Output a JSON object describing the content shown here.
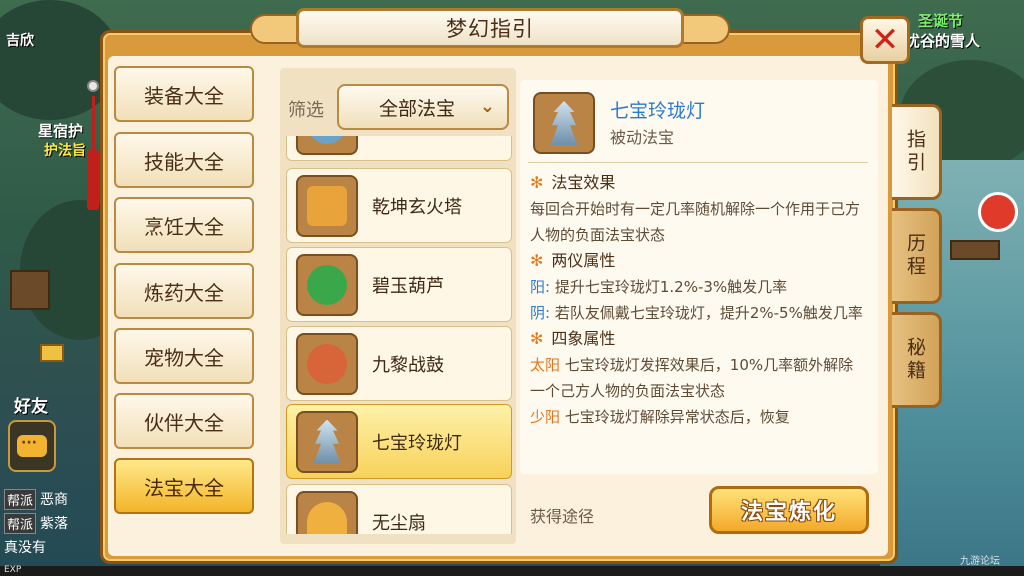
{
  "window": {
    "title": "梦幻指引",
    "close_label": "✕"
  },
  "hud": {
    "top_left": "吉欣",
    "npc_name_1": "星宿护",
    "npc_name_2": "护法旨",
    "friends_label": "好友",
    "event_title": "圣诞节",
    "event_sub": "忧谷的雪人",
    "chat": [
      {
        "tag": "帮派",
        "text": "恶商"
      },
      {
        "tag": "帮派",
        "text": "紫落"
      }
    ],
    "chat_extra": "真没有",
    "exp_label": "EXP",
    "watermark": "九游论坛"
  },
  "menu": {
    "items": [
      {
        "label": "装备大全",
        "active": false
      },
      {
        "label": "技能大全",
        "active": false
      },
      {
        "label": "烹饪大全",
        "active": false
      },
      {
        "label": "炼药大全",
        "active": false
      },
      {
        "label": "宠物大全",
        "active": false
      },
      {
        "label": "伙伴大全",
        "active": false
      },
      {
        "label": "法宝大全",
        "active": true
      }
    ]
  },
  "filter": {
    "label": "筛选",
    "value": "全部法宝"
  },
  "list": {
    "items": [
      {
        "name": "",
        "icon": "beast-icon",
        "color": "#6aa2c8"
      },
      {
        "name": "乾坤玄火塔",
        "icon": "fire-tower-icon",
        "color": "#e8a43a"
      },
      {
        "name": "碧玉葫芦",
        "icon": "gourd-icon",
        "color": "#3aa84a"
      },
      {
        "name": "九黎战鼓",
        "icon": "drum-icon",
        "color": "#d8643a"
      },
      {
        "name": "七宝玲珑灯",
        "icon": "lantern-icon",
        "color": "#8fb0c8",
        "selected": true
      },
      {
        "name": "无尘扇",
        "icon": "fan-icon",
        "color": "#f0b040"
      }
    ]
  },
  "detail": {
    "name": "七宝玲珑灯",
    "type": "被动法宝",
    "sections": {
      "effect_title": "法宝效果",
      "effect_text": "每回合开始时有一定几率随机解除一个作用于己方人物的负面法宝状态",
      "two_title": "两仪属性",
      "yang_label": "阳:",
      "yang_text": "提升七宝玲珑灯1.2%-3%触发几率",
      "yin_label": "阴:",
      "yin_text": "若队友佩戴七宝玲珑灯，提升2%-5%触发几率",
      "four_title": "四象属性",
      "taiyang_label": "太阳",
      "taiyang_text": "七宝玲珑灯发挥效果后，10%几率额外解除一个己方人物的负面法宝状态",
      "shaoyang_label": "少阳",
      "shaoyang_text": "七宝玲珑灯解除异常状态后，恢复"
    },
    "obtain_label": "获得途径",
    "refine_label": "法宝炼化"
  },
  "side_tabs": [
    {
      "label": "指引",
      "active": true
    },
    {
      "label": "历程",
      "active": false
    },
    {
      "label": "秘籍",
      "active": false
    }
  ]
}
